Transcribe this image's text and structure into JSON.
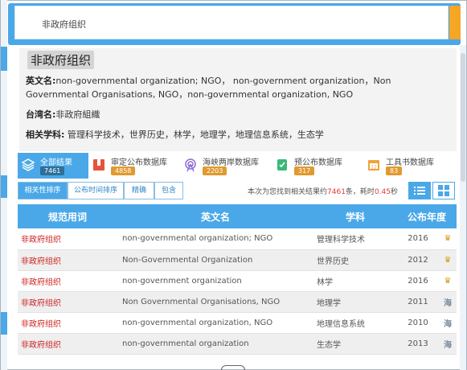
{
  "search": {
    "query": "非政府组织"
  },
  "entry": {
    "title": "非政府组织",
    "english_label": "英文名:",
    "english_value": "non-governmental organization; NGO， non-government organization，Non Governmental Organisations, NGO，non-governmental organization, NGO",
    "taiwan_label": "台湾名:",
    "taiwan_value": "非政府組織",
    "subject_label": "相关学科:",
    "subject_value": "管理科学技术，世界历史，林学，地理学，地理信息系统，生态学"
  },
  "categories": [
    {
      "label": "全部结果",
      "count": "7461",
      "icon": "layers-icon"
    },
    {
      "label": "审定公布数据库",
      "count": "4858",
      "icon": "book-icon"
    },
    {
      "label": "海峡两岸数据库",
      "count": "2203",
      "icon": "broadcast-icon"
    },
    {
      "label": "预公布数据库",
      "count": "317",
      "icon": "document-check-icon"
    },
    {
      "label": "工具书数据库",
      "count": "83",
      "icon": "calendar-icon"
    }
  ],
  "sort": {
    "buttons": [
      "相关性排序",
      "公布时间排序",
      "精确",
      "包含"
    ],
    "summary_prefix": "本次为您找到相关结果约",
    "summary_count": "7461",
    "summary_mid": "条，耗时",
    "summary_time": "0.45",
    "summary_suffix": "秒"
  },
  "table": {
    "headers": [
      "规范用词",
      "英文名",
      "学科",
      "公布年度"
    ],
    "rows": [
      {
        "term": "非政府组织",
        "english": "non-governmental organization; NGO",
        "subject": "管理科学技术",
        "year": "2016",
        "flag": "gold"
      },
      {
        "term": "非政府组织",
        "english": "Non-Governmental Organization",
        "subject": "世界历史",
        "year": "2012",
        "flag": "gold"
      },
      {
        "term": "非政府组织",
        "english": "non-government organization",
        "subject": "林学",
        "year": "2016",
        "flag": "gold"
      },
      {
        "term": "非政府组织",
        "english": "Non Governmental Organisations, NGO",
        "subject": "地理学",
        "year": "2011",
        "flag": "海"
      },
      {
        "term": "非政府组织",
        "english": "non-governmental organization, NGO",
        "subject": "地理信息系统",
        "year": "2010",
        "flag": "海"
      },
      {
        "term": "非政府组织",
        "english": "non-governmental organization",
        "subject": "生态学",
        "year": "2013",
        "flag": "海"
      }
    ]
  },
  "colors": {
    "accent": "#4aa8e8",
    "orange": "#f5a623",
    "term_red": "#cc2222"
  }
}
